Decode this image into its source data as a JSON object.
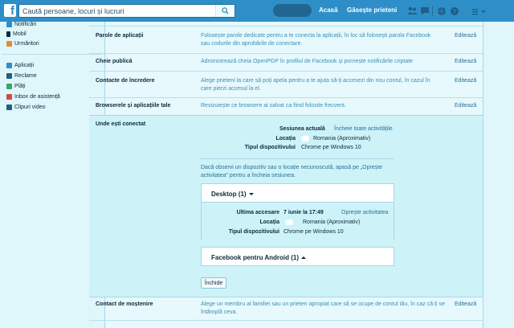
{
  "topbar": {
    "logo": "f",
    "search_placeholder": "Caută persoane, locuri și lucruri",
    "nav_home": "Acasă",
    "nav_find_friends": "Găsește prieteni",
    "icons": [
      "friends-icon",
      "messages-icon",
      "globe-icon",
      "help-icon",
      "settings-icon"
    ]
  },
  "sidebar": {
    "top_items": [
      {
        "label": "Notificări",
        "icon": "bell-icon"
      },
      {
        "label": "Mobil",
        "icon": "mobile-icon"
      },
      {
        "label": "Urmăritori",
        "icon": "rss-icon"
      }
    ],
    "bottom_items": [
      {
        "label": "Aplicații",
        "icon": "apps-icon"
      },
      {
        "label": "Reclame",
        "icon": "ads-icon"
      },
      {
        "label": "Plăți",
        "icon": "payments-icon"
      },
      {
        "label": "Inbox de asistență",
        "icon": "inbox-icon"
      },
      {
        "label": "Clipuri video",
        "icon": "video-icon"
      }
    ]
  },
  "rows": {
    "app_passwords": {
      "label": "Parole de aplicații",
      "desc": "Folosește parole dedicate pentru a te conecta la aplicații, în loc să folosești parola Facebook sau codurile din aprobările de conectare.",
      "edit": "Editează"
    },
    "public_key": {
      "label": "Cheie publică",
      "desc": "Administrează cheia OpenPGP în profilul de Facebook și pornește notificările criptate",
      "edit": "Editează"
    },
    "trusted_contacts": {
      "label": "Contacte de încredere",
      "desc": "Alege prieteni la care să poți apela pentru a te ajuta să-ți accesezi din nou contul, în cazul în care pierzi accesul la el.",
      "edit": "Editează"
    },
    "browsers": {
      "label": "Browserele și aplicațiile tale",
      "desc": "Revizuiește ce browsere ai salvat ca fiind folosite frecvent.",
      "edit": "Editează"
    },
    "legacy_contact": {
      "label": "Contact de moștenire",
      "desc": "Alege un membru al familiei sau un prieten apropiat care să se ocupe de contul tău, în caz că ți se întâmplă ceva.",
      "edit": "Editează"
    }
  },
  "where_logged_in": {
    "label": "Unde ești conectat",
    "current_session_label": "Sesiunea actuală",
    "end_all": "Încheie toate activitățile",
    "location_label": "Locația",
    "location_value": "Romania (Aproximativ)",
    "device_label": "Tipul dispozitivului",
    "device_value": "Chrome pe Windows 10",
    "notice": "Dacă observi un dispozitiv sau o locație necunoscută, apasă pe „Oprește activitatea” pentru a încheia sesiunea.",
    "desktop": {
      "title": "Desktop (1)",
      "last_access_label": "Ultima accesare",
      "last_access_value": "7 iunie la 17:49",
      "stop": "Oprește activitatea",
      "location_label": "Locația",
      "location_value": "Romania (Aproximativ)",
      "device_label": "Tipul dispozitivului",
      "device_value": "Chrome pe Windows 10"
    },
    "android": {
      "title": "Facebook pentru Android (1)"
    },
    "close": "Închide"
  }
}
